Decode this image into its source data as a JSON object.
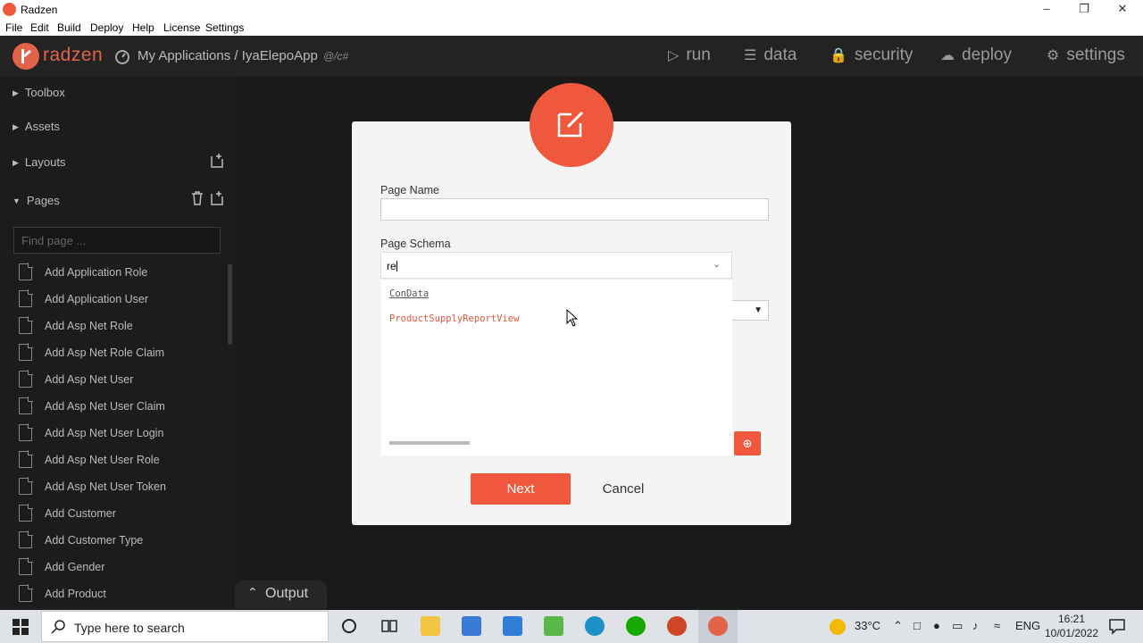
{
  "window": {
    "title": "Radzen"
  },
  "menu": [
    "File",
    "Edit",
    "Build",
    "Deploy",
    "Help",
    "License",
    "Settings"
  ],
  "header": {
    "logo": "radzen",
    "breadcrumb": "My Applications / IyaElepoApp",
    "breadcrumb_tag": "@/c#",
    "nav": [
      {
        "label": "run",
        "icon": "play-icon"
      },
      {
        "label": "data",
        "icon": "layers-icon"
      },
      {
        "label": "security",
        "icon": "lock-icon"
      },
      {
        "label": "deploy",
        "icon": "cloud-upload-icon"
      },
      {
        "label": "settings",
        "icon": "gear-icon"
      }
    ]
  },
  "sidebar": {
    "sections": [
      "Toolbox",
      "Assets",
      "Layouts",
      "Pages"
    ],
    "find_placeholder": "Find page ...",
    "pages": [
      "Add Application Role",
      "Add Application User",
      "Add Asp Net Role",
      "Add Asp Net Role Claim",
      "Add Asp Net User",
      "Add Asp Net User Claim",
      "Add Asp Net User Login",
      "Add Asp Net User Role",
      "Add Asp Net User Token",
      "Add Customer",
      "Add Customer Type",
      "Add Gender",
      "Add Product"
    ]
  },
  "output": {
    "label": "Output"
  },
  "dialog": {
    "page_name_label": "Page Name",
    "page_name_value": "",
    "schema_label": "Page Schema",
    "schema_value": "re",
    "options": [
      "ConData",
      "ProductSupplyReportView"
    ],
    "hidden_select_arrow": "▼",
    "next_label": "Next",
    "cancel_label": "Cancel"
  },
  "taskbar": {
    "search_placeholder": "Type here to search",
    "weather": "33°C",
    "language": "ENG",
    "time": "16:21",
    "date": "10/01/2022"
  },
  "colors": {
    "accent": "#f0583e",
    "sidebar_bg": "#1c1c1c",
    "header_bg": "#232323"
  }
}
